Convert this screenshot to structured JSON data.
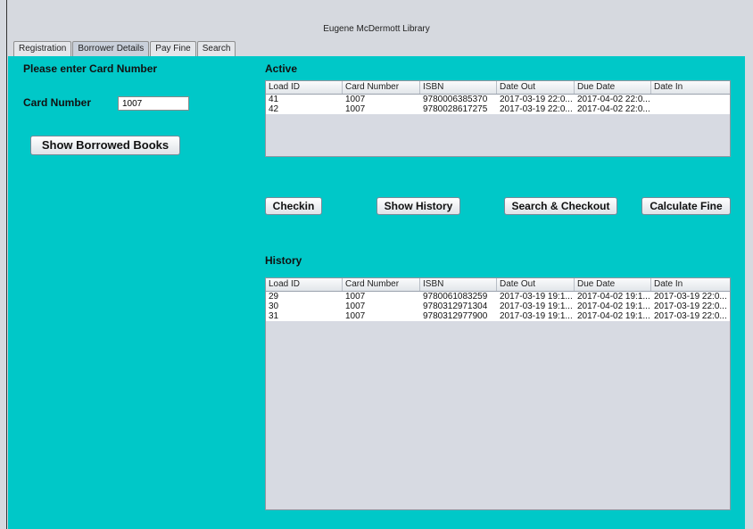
{
  "window": {
    "title": "Eugene McDermott Library"
  },
  "tabs": [
    "Registration",
    "Borrower Details",
    "Pay Fine",
    "Search"
  ],
  "left": {
    "heading": "Please enter Card Number",
    "card_label": "Card Number",
    "card_value": "1007",
    "show_button": "Show Borrowed Books"
  },
  "active": {
    "title": "Active",
    "columns": [
      "Load ID",
      "Card Number",
      "ISBN",
      "Date Out",
      "Due Date",
      "Date In"
    ],
    "rows": [
      [
        "41",
        "1007",
        "9780006385370",
        "2017-03-19 22:0...",
        "2017-04-02 22:0...",
        ""
      ],
      [
        "42",
        "1007",
        "9780028617275",
        "2017-03-19 22:0...",
        "2017-04-02 22:0...",
        ""
      ]
    ]
  },
  "actions": {
    "checkin": "Checkin",
    "history": "Show History",
    "search": "Search & Checkout",
    "fine": "Calculate Fine"
  },
  "history": {
    "title": "History",
    "columns": [
      "Load ID",
      "Card Number",
      "ISBN",
      "Date Out",
      "Due Date",
      "Date In"
    ],
    "rows": [
      [
        "29",
        "1007",
        "9780061083259",
        "2017-03-19 19:1...",
        "2017-04-02 19:1...",
        "2017-03-19 22:0..."
      ],
      [
        "30",
        "1007",
        "9780312971304",
        "2017-03-19 19:1...",
        "2017-04-02 19:1...",
        "2017-03-19 22:0..."
      ],
      [
        "31",
        "1007",
        "9780312977900",
        "2017-03-19 19:1...",
        "2017-04-02 19:1...",
        "2017-03-19 22:0..."
      ]
    ]
  }
}
